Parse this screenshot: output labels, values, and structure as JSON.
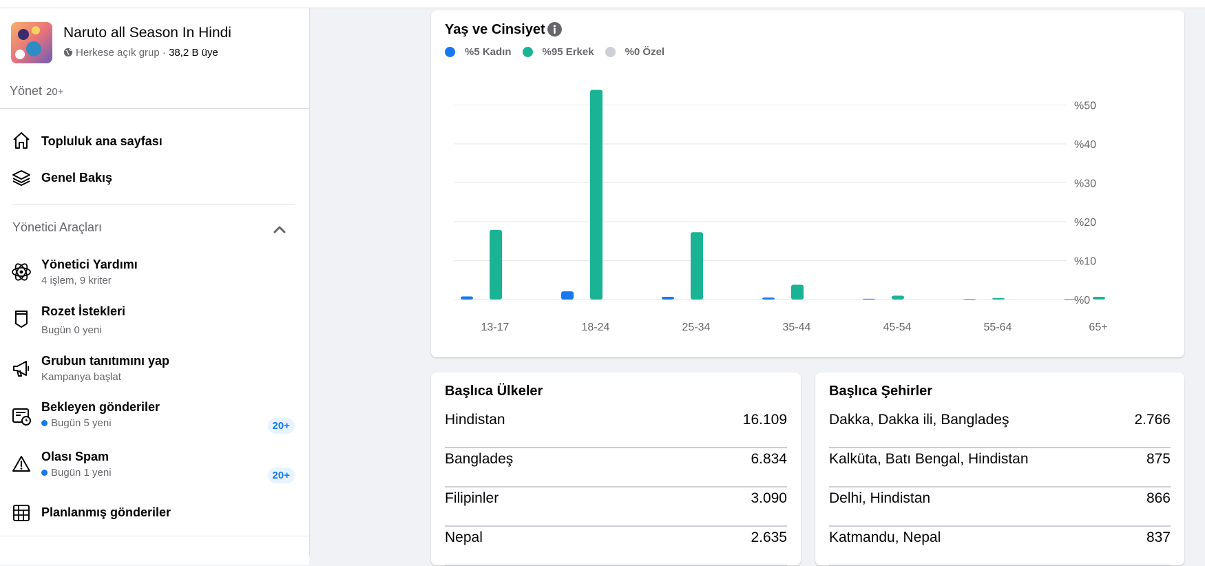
{
  "group": {
    "name": "Naruto all Season In Hindi",
    "privacy": "Herkese açık grup",
    "separator": "·",
    "members": "38,2 B üye"
  },
  "manage": {
    "label": "Yönet",
    "count": "20+"
  },
  "nav": [
    {
      "label": "Topluluk ana sayfası",
      "icon": "home-icon"
    },
    {
      "label": "Genel Bakış",
      "icon": "layers-icon"
    }
  ],
  "admin_tools": {
    "title": "Yönetici Araçları",
    "items": [
      {
        "label": "Yönetici Yardımı",
        "sub": "4 işlem, 9 kriter",
        "icon": "admin-assist-icon"
      },
      {
        "label": "Rozet İstekleri",
        "sub": "Bugün 0 yeni",
        "icon": "badge-icon"
      },
      {
        "label": "Grubun tanıtımını yap",
        "sub": "Kampanya başlat",
        "icon": "megaphone-icon"
      },
      {
        "label": "Bekleyen gönderiler",
        "sub": "Bugün 5 yeni",
        "icon": "pending-posts-icon",
        "badge": "20+"
      },
      {
        "label": "Olası Spam",
        "sub": "Bugün 1 yeni",
        "icon": "warning-icon",
        "badge": "20+"
      },
      {
        "label": "Planlanmış gönderiler",
        "icon": "calendar-icon"
      }
    ]
  },
  "age_gender": {
    "title": "Yaş ve Cinsiyet",
    "legend": [
      "%5 Kadın",
      "%95 Erkek",
      "%0 Özel"
    ],
    "colors": {
      "women": "#1877f2",
      "men": "#1ab394",
      "custom": "#ccd0d5",
      "grid": "#e4e6eb"
    }
  },
  "chart_data": {
    "type": "bar",
    "title": "Yaş ve Cinsiyet",
    "categories": [
      "13-17",
      "18-24",
      "25-34",
      "35-44",
      "45-54",
      "55-64",
      "65+"
    ],
    "series": [
      {
        "name": "%5 Kadın",
        "values": [
          0.8,
          2.1,
          0.7,
          0.5,
          0.2,
          0.1,
          0.1
        ]
      },
      {
        "name": "%95 Erkek",
        "values": [
          17.9,
          53.9,
          17.3,
          3.8,
          1.0,
          0.4,
          0.7
        ]
      },
      {
        "name": "%0 Özel",
        "values": [
          0,
          0,
          0,
          0,
          0,
          0,
          0
        ]
      }
    ],
    "yticks": [
      "%0",
      "%10",
      "%20",
      "%30",
      "%40",
      "%50"
    ],
    "ylim": [
      0,
      55
    ],
    "grid": true,
    "legend_position": "top-left"
  },
  "countries": {
    "title": "Başlıca Ülkeler",
    "rows": [
      {
        "name": "Hindistan",
        "value": "16.109"
      },
      {
        "name": "Bangladeş",
        "value": "6.834"
      },
      {
        "name": "Filipinler",
        "value": "3.090"
      },
      {
        "name": "Nepal",
        "value": "2.635"
      }
    ]
  },
  "cities": {
    "title": "Başlıca Şehirler",
    "rows": [
      {
        "name": "Dakka, Dakka ili, Bangladeş",
        "value": "2.766"
      },
      {
        "name": "Kalküta, Batı Bengal, Hindistan",
        "value": "875"
      },
      {
        "name": "Delhi, Hindistan",
        "value": "866"
      },
      {
        "name": "Katmandu, Nepal",
        "value": "837"
      }
    ]
  }
}
